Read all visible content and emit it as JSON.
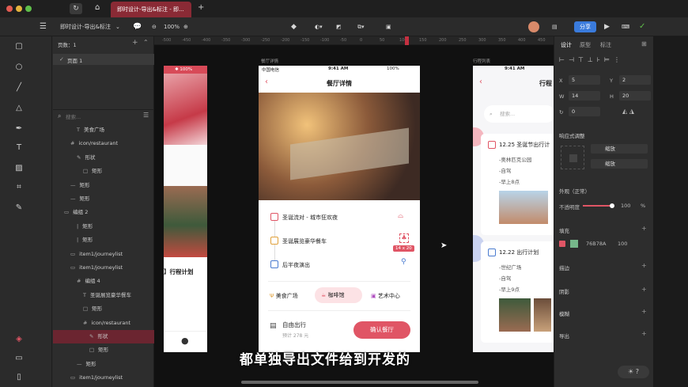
{
  "window": {
    "tab_title": "即时设计-导出&标注 - 即...",
    "new_tab": "+"
  },
  "toolbar": {
    "file_name": "即时设计-导出&标注",
    "zoom": "100%",
    "share": "分享"
  },
  "ruler": {
    "ticks": [
      "-500",
      "-450",
      "-400",
      "-350",
      "-300",
      "-250",
      "-200",
      "-150",
      "-100",
      "-50",
      "0",
      "50",
      "100",
      "150",
      "200",
      "250",
      "300",
      "350",
      "400",
      "450"
    ]
  },
  "layers": {
    "pages_label": "页数：1",
    "page1": "页面 1",
    "search_placeholder": "搜索...",
    "items": [
      {
        "label": "美食广场",
        "indent": 30,
        "icon": "T"
      },
      {
        "label": "icon/restaurant",
        "indent": 22,
        "icon": "#"
      },
      {
        "label": "形状",
        "indent": 30,
        "icon": "✎"
      },
      {
        "label": "矩形",
        "indent": 38,
        "icon": "□"
      },
      {
        "label": "矩形",
        "indent": 22,
        "icon": "—"
      },
      {
        "label": "矩形",
        "indent": 22,
        "icon": "—"
      },
      {
        "label": "编组 2",
        "indent": 14,
        "icon": "▭"
      },
      {
        "label": "矩形",
        "indent": 30,
        "icon": "|"
      },
      {
        "label": "矩形",
        "indent": 30,
        "icon": "|"
      },
      {
        "label": "item1/journeylist",
        "indent": 22,
        "icon": "▭"
      },
      {
        "label": "item1/journeylist",
        "indent": 22,
        "icon": "▭"
      },
      {
        "label": "编组 4",
        "indent": 30,
        "icon": "#"
      },
      {
        "label": "圣诞展览豪华餐车",
        "indent": 38,
        "icon": "T"
      },
      {
        "label": "矩形",
        "indent": 38,
        "icon": "□"
      },
      {
        "label": "icon/restaurant",
        "indent": 38,
        "icon": "#"
      },
      {
        "label": "形状",
        "indent": 46,
        "icon": "✎"
      },
      {
        "label": "矩形",
        "indent": 46,
        "icon": "□"
      },
      {
        "label": "矩形",
        "indent": 30,
        "icon": "—"
      },
      {
        "label": "item1/journeylist",
        "indent": 22,
        "icon": "▭"
      }
    ]
  },
  "canvas": {
    "frame_left_label": "餐厅详情",
    "frame_right_label": "行程列表",
    "left_phone": {
      "battery": "100%",
      "title_partial": "】行程计划"
    },
    "main_phone": {
      "carrier": "中国电信",
      "time": "9:41 AM",
      "battery": "100%",
      "title": "餐厅详情",
      "items": [
        "圣诞流对 - 城市狂欢夜",
        "圣诞展览豪华餐车",
        "后半夜演出"
      ],
      "size_badge": "14 x 20",
      "tabs": [
        "美食广场",
        "咖啡馆",
        "艺术中心"
      ],
      "bottom_title": "自由出行",
      "bottom_sub": "预计 278 元",
      "confirm": "确认餐厅"
    },
    "right_phone": {
      "time": "9:41 AM",
      "title_partial": "行程",
      "search": "搜索...",
      "card1": {
        "title": "12.25 圣诞节出行计",
        "lines": [
          "-奥林匹克公园",
          "-自驾",
          "-早上8点"
        ]
      },
      "card2": {
        "title": "12.22 出行计划",
        "lines": [
          "-世纪广场",
          "-自驾",
          "-早上9点"
        ]
      }
    }
  },
  "subtitle": "都单独导出文件给到开发的",
  "props": {
    "tabs": [
      "设计",
      "原型",
      "标注"
    ],
    "x": "5",
    "y": "2",
    "w": "14",
    "h": "20",
    "rot": "0",
    "responsive": "响应式调整",
    "h_opt": "缩放",
    "v_opt": "缩放",
    "appearance": "外观（正常）",
    "opacity_label": "不透明度",
    "opacity": "100",
    "opacity_unit": "%",
    "fill": "填充",
    "fill_hex": "76B78A",
    "fill_pct": "100",
    "fill_color": "#76b78a",
    "stroke": "描边",
    "shadow": "阴影",
    "blur": "模糊",
    "export": "导出"
  },
  "colors": {
    "accent": "#e05565",
    "brand_tab": "#8a2a35",
    "share": "#3a7bdc"
  }
}
